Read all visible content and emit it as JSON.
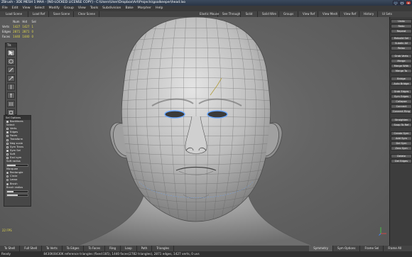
{
  "title": "ZBrush - 3DE MESH 1 MAA - [NO-LOCKED LICENSE COPY] - C:\\Users\\User\\Dropbox\\Art\\Projects\\goalkeeper\\head.lxo",
  "window_controls": [
    "_",
    "▢",
    "✕"
  ],
  "menu": [
    "File",
    "Edit",
    "View",
    "Select",
    "Modify",
    "Group",
    "View",
    "Tools",
    "Subdivision",
    "Bake",
    "Morpher",
    "Help"
  ],
  "toolbar": [
    "Load Scene",
    "Load Ref",
    "Save Scene",
    "Clear Scene",
    "Elastic Mouse",
    "See Through",
    "Solid",
    "Solid Wire",
    "Groups",
    "View Ref",
    "View Mesh",
    "View Ref",
    "History",
    "Ui Sets"
  ],
  "stats": {
    "headers": [
      "",
      "Num",
      "Hid",
      "Sel"
    ],
    "rows": [
      {
        "label": "Verts",
        "num": "1427",
        "hid": "1427",
        "sel": "1"
      },
      {
        "label": "Edges",
        "num": "2871",
        "hid": "2871",
        "sel": "0"
      },
      {
        "label": "Faces",
        "num": "1440",
        "hid": "1440",
        "sel": "0"
      }
    ]
  },
  "tool_palette_title": "Tls",
  "tools": [
    "select-tool",
    "brush-tool",
    "knife-tool",
    "extrude-tool",
    "bevel-tool",
    "cut-tool",
    "weld-tool",
    "move-tool"
  ],
  "selection_options": {
    "title": "Sel Options",
    "backfaces_label": "Backfaces",
    "select_label": "Select",
    "items": [
      {
        "label": "Verts",
        "on": false
      },
      {
        "label": "Edges",
        "on": true
      },
      {
        "label": "Faces",
        "on": false
      },
      {
        "label": "Transform",
        "on": false
      },
      {
        "label": "Neg scale",
        "on": false
      },
      {
        "label": "Sym Trans",
        "on": false
      },
      {
        "label": "Sym Sel",
        "on": true
      },
      {
        "label": "Soft",
        "on": false
      },
      {
        "label": "Excl sym",
        "on": false
      }
    ],
    "softradius_label": "Soft radius",
    "softradius_value": 0.4,
    "marquee_label": "Marquee",
    "marquee": [
      {
        "label": "Rectangle",
        "on": true
      },
      {
        "label": "Circle",
        "on": false
      },
      {
        "label": "Lasso",
        "on": false
      },
      {
        "label": "Brush",
        "on": true
      }
    ],
    "brushradius_label": "Brush radius",
    "brushradius_value": 0.3,
    "intensity_value": 0.5
  },
  "right_panel": [
    "Undo",
    "Redo",
    "Repeat",
    "Rebuild Sel",
    "Subdiv All",
    "Relax",
    "Grab Verts",
    "Merge",
    "Merge With",
    "Merge To",
    "Bridge",
    "Auto Bridge",
    "Grab Edges",
    "Sym Edges",
    "Collapse",
    "Connect",
    "Connect Ring",
    "Straighten",
    "Snap To Ref",
    "Create Sym",
    "Add Sym",
    "Del Sym",
    "Zero Sym",
    "Delete",
    "Del Edges"
  ],
  "fps": "22 FPS",
  "bottombar": [
    "To Shell",
    "Full Shell",
    "To Verts",
    "To Edges",
    "To Faces",
    "Ring",
    "Loop",
    "Path",
    "Triangles",
    "Symmetry",
    "Sym Options",
    "Frame Sel",
    "Frame All"
  ],
  "status": {
    "ready": "Ready",
    "counts": "8430K/8430K reference triangles (fixed:185), 1440 faces(2782 triangles), 2871 edges, 1427 verts, 0 uvs"
  },
  "accent_yellow": "#e2d84a",
  "eye_highlight": "#6aa8ff"
}
